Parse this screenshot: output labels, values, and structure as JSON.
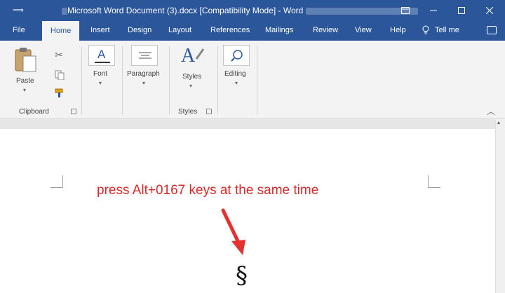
{
  "titlebar": {
    "title": "Microsoft Word Document (3).docx [Compatibility Mode] - Word",
    "qat_icon": "customize-icon",
    "buttons": [
      "ribbon-display-icon",
      "minimize-icon",
      "maximize-icon",
      "close-icon"
    ]
  },
  "tabs": [
    {
      "label": "File"
    },
    {
      "label": "Home"
    },
    {
      "label": "Insert"
    },
    {
      "label": "Design"
    },
    {
      "label": "Layout"
    },
    {
      "label": "References"
    },
    {
      "label": "Mailings"
    },
    {
      "label": "Review"
    },
    {
      "label": "View"
    },
    {
      "label": "Help"
    }
  ],
  "tellme": {
    "label": "Tell me"
  },
  "ribbon": {
    "clipboard": {
      "paste_label": "Paste",
      "group_label": "Clipboard"
    },
    "font": {
      "label": "Font"
    },
    "paragraph": {
      "label": "Paragraph"
    },
    "styles": {
      "label": "Styles",
      "group_label": "Styles"
    },
    "editing": {
      "label": "Editing"
    }
  },
  "document": {
    "annotation": "press Alt+0167 keys at the same time",
    "symbol": "§"
  },
  "colors": {
    "accent": "#2b579a",
    "annotation": "#d62a2a"
  }
}
